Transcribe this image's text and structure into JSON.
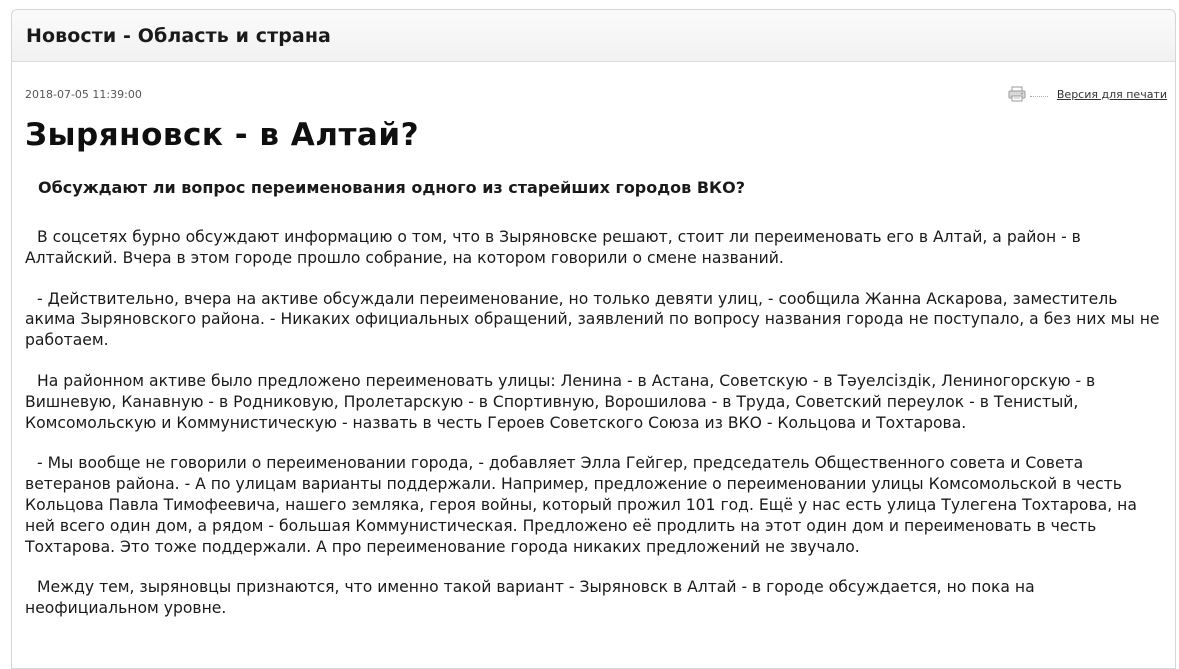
{
  "section": {
    "title": "Новости - Область и страна"
  },
  "article": {
    "date": "2018-07-05 11:39:00",
    "print_label": "Версия для печати",
    "print_icon": "printer-icon",
    "title": "Зыряновск - в Алтай?",
    "lead": "Обсуждают ли вопрос переименования одного из старейших городов ВКО?",
    "paragraphs": [
      "В соцсетях бурно обсуждают информацию о том, что в Зыряновске решают, стоит ли переименовать его в Алтай, а район - в Алтайский. Вчера в этом городе прошло собрание, на котором говорили о смене названий.",
      "- Действительно, вчера на активе обсуждали переименование, но только девяти улиц, - сообщила Жанна Аскарова, заместитель акима Зыряновского района. - Никаких официальных обращений, заявлений по вопросу названия города не поступало, а без них мы не работаем.",
      "На районном активе было предложено переименовать улицы: Ленина - в Астана, Советскую - в Тәуелсіздік, Лениногорскую - в Вишневую, Канавную - в Родниковую, Пролетарскую - в Спортивную, Ворошилова - в Труда, Советский переулок - в Тенистый, Комсомольскую и Коммунистическую - назвать в честь Героев Советского Союза из ВКО - Кольцова и Тохтарова.",
      "- Мы вообще не говорили о переименовании города, - добавляет Элла Гейгер, председатель Общественного совета и Совета ветеранов района. - А по улицам варианты поддержали. Например, предложение о переименовании улицы Комсомольской в честь Кольцова Павла Тимофеевича, нашего земляка, героя войны, который прожил 101 год. Ещё у нас есть улица Тулегена Тохтарова, на ней всего один дом, а рядом - большая Коммунистическая. Предложено её продлить на этот один дом и переименовать в честь Тохтарова. Это тоже поддержали. А про переименование города никаких предложений не звучало.",
      "Между тем, зыряновцы признаются, что именно такой вариант - Зыряновск в Алтай - в городе обсуждается, но пока на неофициальном уровне."
    ]
  },
  "colors": {
    "text": "#1a1a1a",
    "header_bg": "#f1f1f1",
    "border": "#d6d6d6",
    "date": "#555555"
  }
}
